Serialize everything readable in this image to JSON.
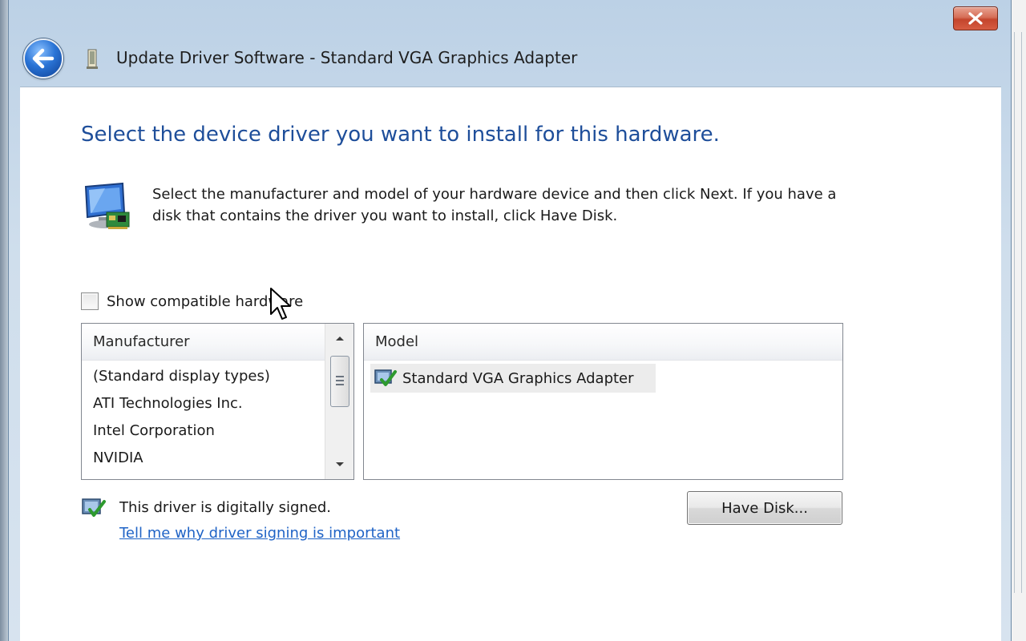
{
  "window": {
    "title": "Update Driver Software - Standard VGA Graphics Adapter",
    "close_icon": "close-icon",
    "back_icon": "back-arrow-icon"
  },
  "content": {
    "heading": "Select the device driver you want to install for this hardware.",
    "instructions": "Select the manufacturer and model of your hardware device and then click Next. If you have a disk that contains the driver you want to install, click Have Disk.",
    "show_compatible_label": "Show compatible hardware",
    "show_compatible_checked": false
  },
  "manufacturer_list": {
    "header": "Manufacturer",
    "items": [
      "(Standard display types)",
      "ATI Technologies Inc.",
      "Intel Corporation",
      "NVIDIA"
    ]
  },
  "model_list": {
    "header": "Model",
    "items": [
      "Standard VGA Graphics Adapter"
    ]
  },
  "signing": {
    "status": "This driver is digitally signed.",
    "link": "Tell me why driver signing is important"
  },
  "buttons": {
    "have_disk": "Have Disk..."
  },
  "colors": {
    "heading": "#1e4e9a",
    "link": "#1f63c6",
    "close_button": "#c4452c"
  }
}
